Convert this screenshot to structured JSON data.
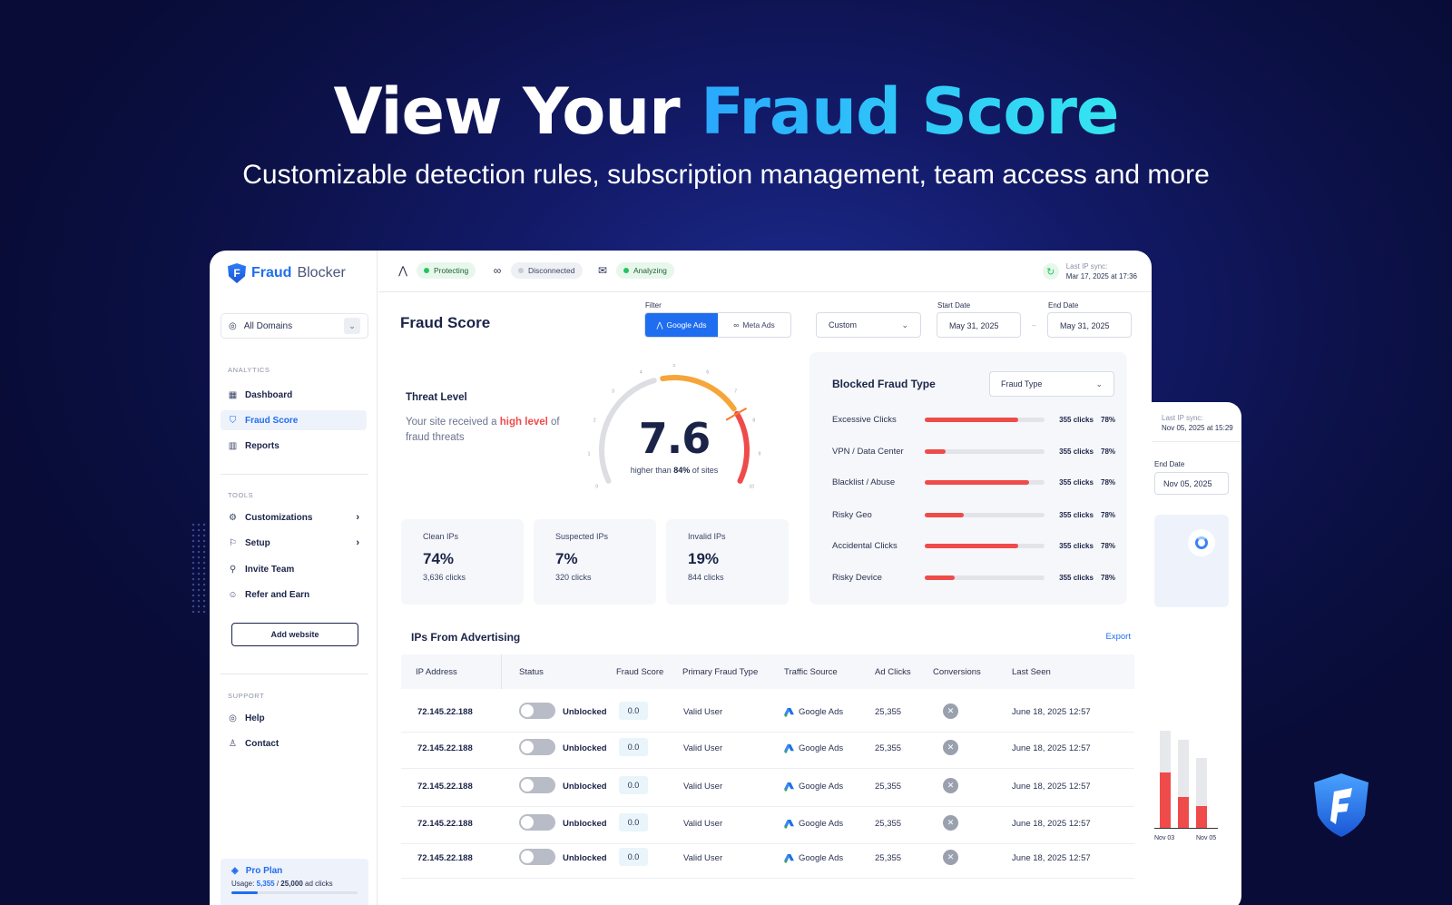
{
  "hero": {
    "title_part1": "View Your ",
    "title_part2": "Fraud Score",
    "subtitle": "Customizable detection rules, subscription management, team access and more"
  },
  "colors": {
    "brand": "#1f6ef0",
    "danger": "#ef4b4b",
    "success": "#22c55e",
    "navy": "#1b2448"
  },
  "app": {
    "logo_part1": "Fraud",
    "logo_part2": "Blocker",
    "domain_select": "All Domains",
    "sections": {
      "analytics": "ANALYTICS",
      "tools": "TOOLS",
      "support": "SUPPORT"
    },
    "nav": {
      "dashboard": "Dashboard",
      "fraud_score": "Fraud Score",
      "reports": "Reports",
      "customizations": "Customizations",
      "setup": "Setup",
      "invite_team": "Invite Team",
      "refer": "Refer and Earn",
      "help": "Help",
      "contact": "Contact"
    },
    "add_website": "Add website",
    "plan": {
      "name": "Pro Plan",
      "usage_label": "Usage:",
      "used": "5,355",
      "sep": " / ",
      "limit": "25,000",
      "unit": " ad clicks",
      "fraction": 0.21
    }
  },
  "topbar": {
    "google_status": "Protecting",
    "meta_status": "Disconnected",
    "email_status": "Analyzing",
    "sync_label": "Last IP sync:",
    "sync_value": "Mar 17, 2025 at 17:36"
  },
  "page": {
    "title": "Fraud Score",
    "filter_label": "Filter",
    "filter_google": "Google Ads",
    "filter_meta": "Meta Ads",
    "range": "Custom",
    "start_label": "Start Date",
    "start_value": "May 31, 2025",
    "end_label": "End Date",
    "end_value": "May 31, 2025",
    "date_dash": "–"
  },
  "threat": {
    "title": "Threat Level",
    "desc_pre": "Your site received a ",
    "desc_hl": "high level",
    "desc_post": " of fraud threats",
    "score": "7.6",
    "score_value": 7.6,
    "sub_pre": "higher than ",
    "sub_pct": "84%",
    "sub_post": " of sites",
    "ticks": [
      "0",
      "1",
      "2",
      "3",
      "4",
      "5",
      "6",
      "7",
      "8",
      "9",
      "10"
    ]
  },
  "stats": [
    {
      "label": "Clean IPs",
      "value": "74%",
      "count": "3,636 clicks"
    },
    {
      "label": "Suspected IPs",
      "value": "7%",
      "count": "320 clicks"
    },
    {
      "label": "Invalid IPs",
      "value": "19%",
      "count": "844 clicks"
    }
  ],
  "blocked": {
    "title": "Blocked Fraud Type",
    "select": "Fraud Type",
    "rows": [
      {
        "label": "Excessive Clicks",
        "clicks": "355 clicks",
        "pct": "78%",
        "fill": 0.78
      },
      {
        "label": "VPN / Data Center",
        "clicks": "355 clicks",
        "pct": "78%",
        "fill": 0.18
      },
      {
        "label": "Blacklist / Abuse",
        "clicks": "355 clicks",
        "pct": "78%",
        "fill": 0.87
      },
      {
        "label": "Risky Geo",
        "clicks": "355 clicks",
        "pct": "78%",
        "fill": 0.33
      },
      {
        "label": "Accidental Clicks",
        "clicks": "355 clicks",
        "pct": "78%",
        "fill": 0.78
      },
      {
        "label": "Risky Device",
        "clicks": "355 clicks",
        "pct": "78%",
        "fill": 0.25
      }
    ]
  },
  "table": {
    "title": "IPs From Advertising",
    "export": "Export",
    "headers": [
      "IP Address",
      "Status",
      "Fraud Score",
      "Primary Fraud Type",
      "Traffic Source",
      "Ad Clicks",
      "Conversions",
      "Last Seen"
    ],
    "rows": [
      {
        "ip": "72.145.22.188",
        "status": "Unblocked",
        "score": "0.0",
        "type": "Valid User",
        "source": "Google Ads",
        "clicks": "25,355",
        "last_seen": "June 18, 2025 12:57"
      },
      {
        "ip": "72.145.22.188",
        "status": "Unblocked",
        "score": "0.0",
        "type": "Valid User",
        "source": "Google Ads",
        "clicks": "25,355",
        "last_seen": "June 18, 2025 12:57"
      },
      {
        "ip": "72.145.22.188",
        "status": "Unblocked",
        "score": "0.0",
        "type": "Valid User",
        "source": "Google Ads",
        "clicks": "25,355",
        "last_seen": "June 18, 2025 12:57"
      },
      {
        "ip": "72.145.22.188",
        "status": "Unblocked",
        "score": "0.0",
        "type": "Valid User",
        "source": "Google Ads",
        "clicks": "25,355",
        "last_seen": "June 18, 2025 12:57"
      },
      {
        "ip": "72.145.22.188",
        "status": "Unblocked",
        "score": "0.0",
        "type": "Valid User",
        "source": "Google Ads",
        "clicks": "25,355",
        "last_seen": "June 18, 2025 12:57"
      }
    ]
  },
  "back_card": {
    "sync_label": "Last IP sync:",
    "sync_value": "Nov 05, 2025 at 15:29",
    "end_label": "End Date",
    "end_value": "Nov 05, 2025",
    "x_labels": [
      "Nov 03",
      "Nov 05"
    ]
  }
}
